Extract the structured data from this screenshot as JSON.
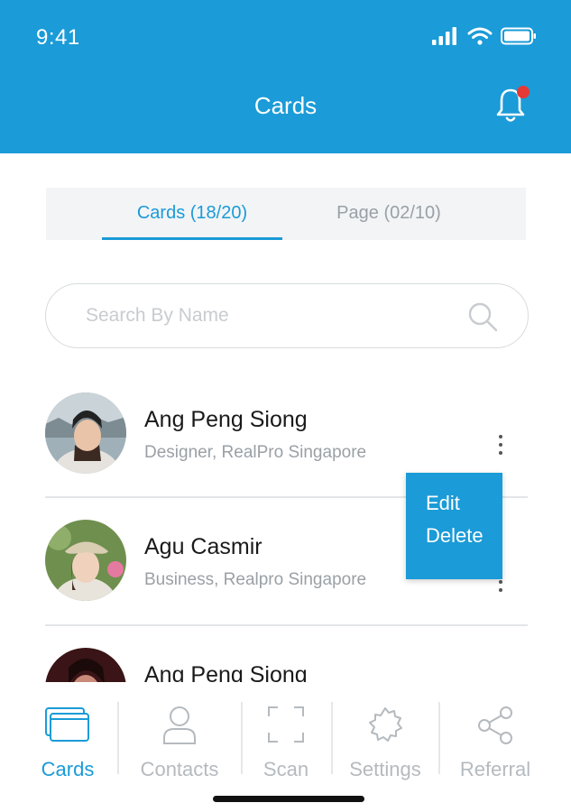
{
  "status_bar": {
    "time": "9:41"
  },
  "header": {
    "title": "Cards",
    "has_notification": true
  },
  "tabs": [
    {
      "label": "Cards (18/20)",
      "active": true
    },
    {
      "label": "Page (02/10)",
      "active": false
    }
  ],
  "search": {
    "placeholder": "Search By Name",
    "value": ""
  },
  "contacts": [
    {
      "name": "Ang Peng Siong",
      "subtitle": "Designer, RealPro Singapore"
    },
    {
      "name": "Agu Casmir",
      "subtitle": "Business, Realpro Singapore"
    },
    {
      "name": "Ang Peng Siong",
      "subtitle": ""
    }
  ],
  "context_menu": {
    "items": [
      "Edit",
      "Delete"
    ]
  },
  "bottom_nav": [
    {
      "label": "Cards",
      "icon": "cards-icon",
      "active": true
    },
    {
      "label": "Contacts",
      "icon": "person-icon",
      "active": false
    },
    {
      "label": "Scan",
      "icon": "scan-icon",
      "active": false
    },
    {
      "label": "Settings",
      "icon": "gear-icon",
      "active": false
    },
    {
      "label": "Referral",
      "icon": "share-icon",
      "active": false
    }
  ],
  "colors": {
    "primary": "#1b9bd7",
    "notification": "#e53935",
    "inactive": "#b5babf"
  }
}
